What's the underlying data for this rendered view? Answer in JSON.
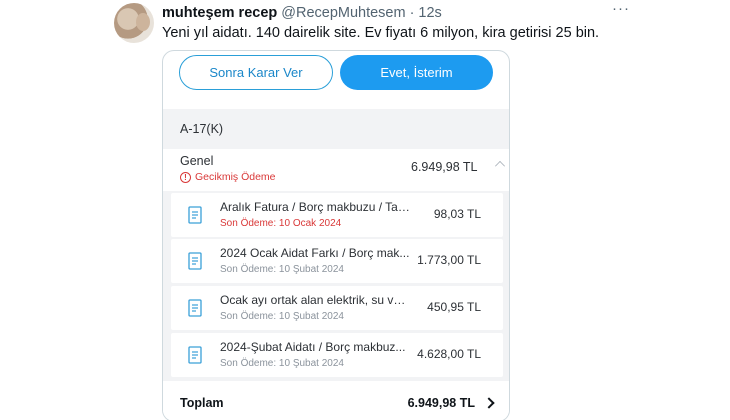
{
  "tweet": {
    "display_name": "muhteşem recep",
    "handle": "@RecepMuhtesem",
    "separator": "·",
    "time": "12s",
    "text": "Yeni yıl aidatı. 140 dairelik site. Ev fiyatı 6 milyon, kira getirisi 25 bin."
  },
  "card": {
    "buttons": {
      "later": "Sonra Karar Ver",
      "yes": "Evet, İsterim"
    },
    "account": "A-17(K)",
    "group": {
      "label": "Genel",
      "status": "Gecikmiş Ödeme",
      "amount": "6.949,98 TL"
    },
    "items": [
      {
        "title": "Aralık Fatura / Borç makbuzu /  Tazm...",
        "due": "Son Ödeme: 10 Ocak 2024",
        "amount": "98,03 TL",
        "overdue": true
      },
      {
        "title": "2024 Ocak Aidat Farkı / Borç mak...",
        "due": "Son Ödeme: 10 Şubat 2024",
        "amount": "1.773,00 TL",
        "overdue": false
      },
      {
        "title": "Ocak ayı ortak alan elektrik, su ve...",
        "due": "Son Ödeme: 10 Şubat 2024",
        "amount": "450,95 TL",
        "overdue": false
      },
      {
        "title": "2024-Şubat Aidatı / Borç makbuz...",
        "due": "Son Ödeme: 10 Şubat 2024",
        "amount": "4.628,00 TL",
        "overdue": false
      }
    ],
    "total": {
      "label": "Toplam",
      "amount": "6.949,98 TL"
    }
  },
  "colors": {
    "accent": "#1d9bf0",
    "overdue": "#d93838",
    "muted": "#536471"
  },
  "icons": [
    "avatar",
    "more-icon",
    "alert-icon",
    "chevron-up-icon",
    "document-icon",
    "chevron-right-icon"
  ]
}
